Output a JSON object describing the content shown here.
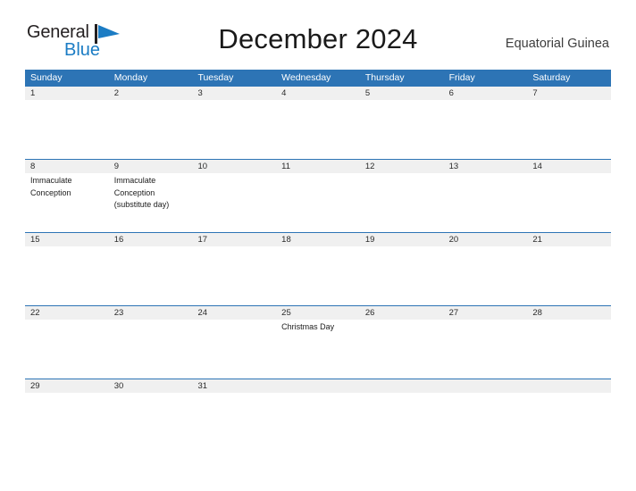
{
  "brand": {
    "word1": "General",
    "word2": "Blue",
    "flag_icon": "blue-flag-icon",
    "color_word1": "#231f20",
    "color_word2": "#1b7cc4"
  },
  "header": {
    "title": "December 2024",
    "country": "Equatorial Guinea"
  },
  "theme": {
    "header_blue": "#2d74b5",
    "date_band_gray": "#f0f0f0",
    "text_dark": "#2a2a2a"
  },
  "calendar": {
    "weekdays": [
      "Sunday",
      "Monday",
      "Tuesday",
      "Wednesday",
      "Thursday",
      "Friday",
      "Saturday"
    ],
    "weeks": [
      {
        "days": [
          {
            "num": "1",
            "events": ""
          },
          {
            "num": "2",
            "events": ""
          },
          {
            "num": "3",
            "events": ""
          },
          {
            "num": "4",
            "events": ""
          },
          {
            "num": "5",
            "events": ""
          },
          {
            "num": "6",
            "events": ""
          },
          {
            "num": "7",
            "events": ""
          }
        ]
      },
      {
        "days": [
          {
            "num": "8",
            "events": "Immaculate Conception"
          },
          {
            "num": "9",
            "events": "Immaculate Conception (substitute day)"
          },
          {
            "num": "10",
            "events": ""
          },
          {
            "num": "11",
            "events": ""
          },
          {
            "num": "12",
            "events": ""
          },
          {
            "num": "13",
            "events": ""
          },
          {
            "num": "14",
            "events": ""
          }
        ]
      },
      {
        "days": [
          {
            "num": "15",
            "events": ""
          },
          {
            "num": "16",
            "events": ""
          },
          {
            "num": "17",
            "events": ""
          },
          {
            "num": "18",
            "events": ""
          },
          {
            "num": "19",
            "events": ""
          },
          {
            "num": "20",
            "events": ""
          },
          {
            "num": "21",
            "events": ""
          }
        ]
      },
      {
        "days": [
          {
            "num": "22",
            "events": ""
          },
          {
            "num": "23",
            "events": ""
          },
          {
            "num": "24",
            "events": ""
          },
          {
            "num": "25",
            "events": "Christmas Day"
          },
          {
            "num": "26",
            "events": ""
          },
          {
            "num": "27",
            "events": ""
          },
          {
            "num": "28",
            "events": ""
          }
        ]
      },
      {
        "days": [
          {
            "num": "29",
            "events": ""
          },
          {
            "num": "30",
            "events": ""
          },
          {
            "num": "31",
            "events": ""
          },
          {
            "num": "",
            "events": ""
          },
          {
            "num": "",
            "events": ""
          },
          {
            "num": "",
            "events": ""
          },
          {
            "num": "",
            "events": ""
          }
        ]
      }
    ]
  }
}
